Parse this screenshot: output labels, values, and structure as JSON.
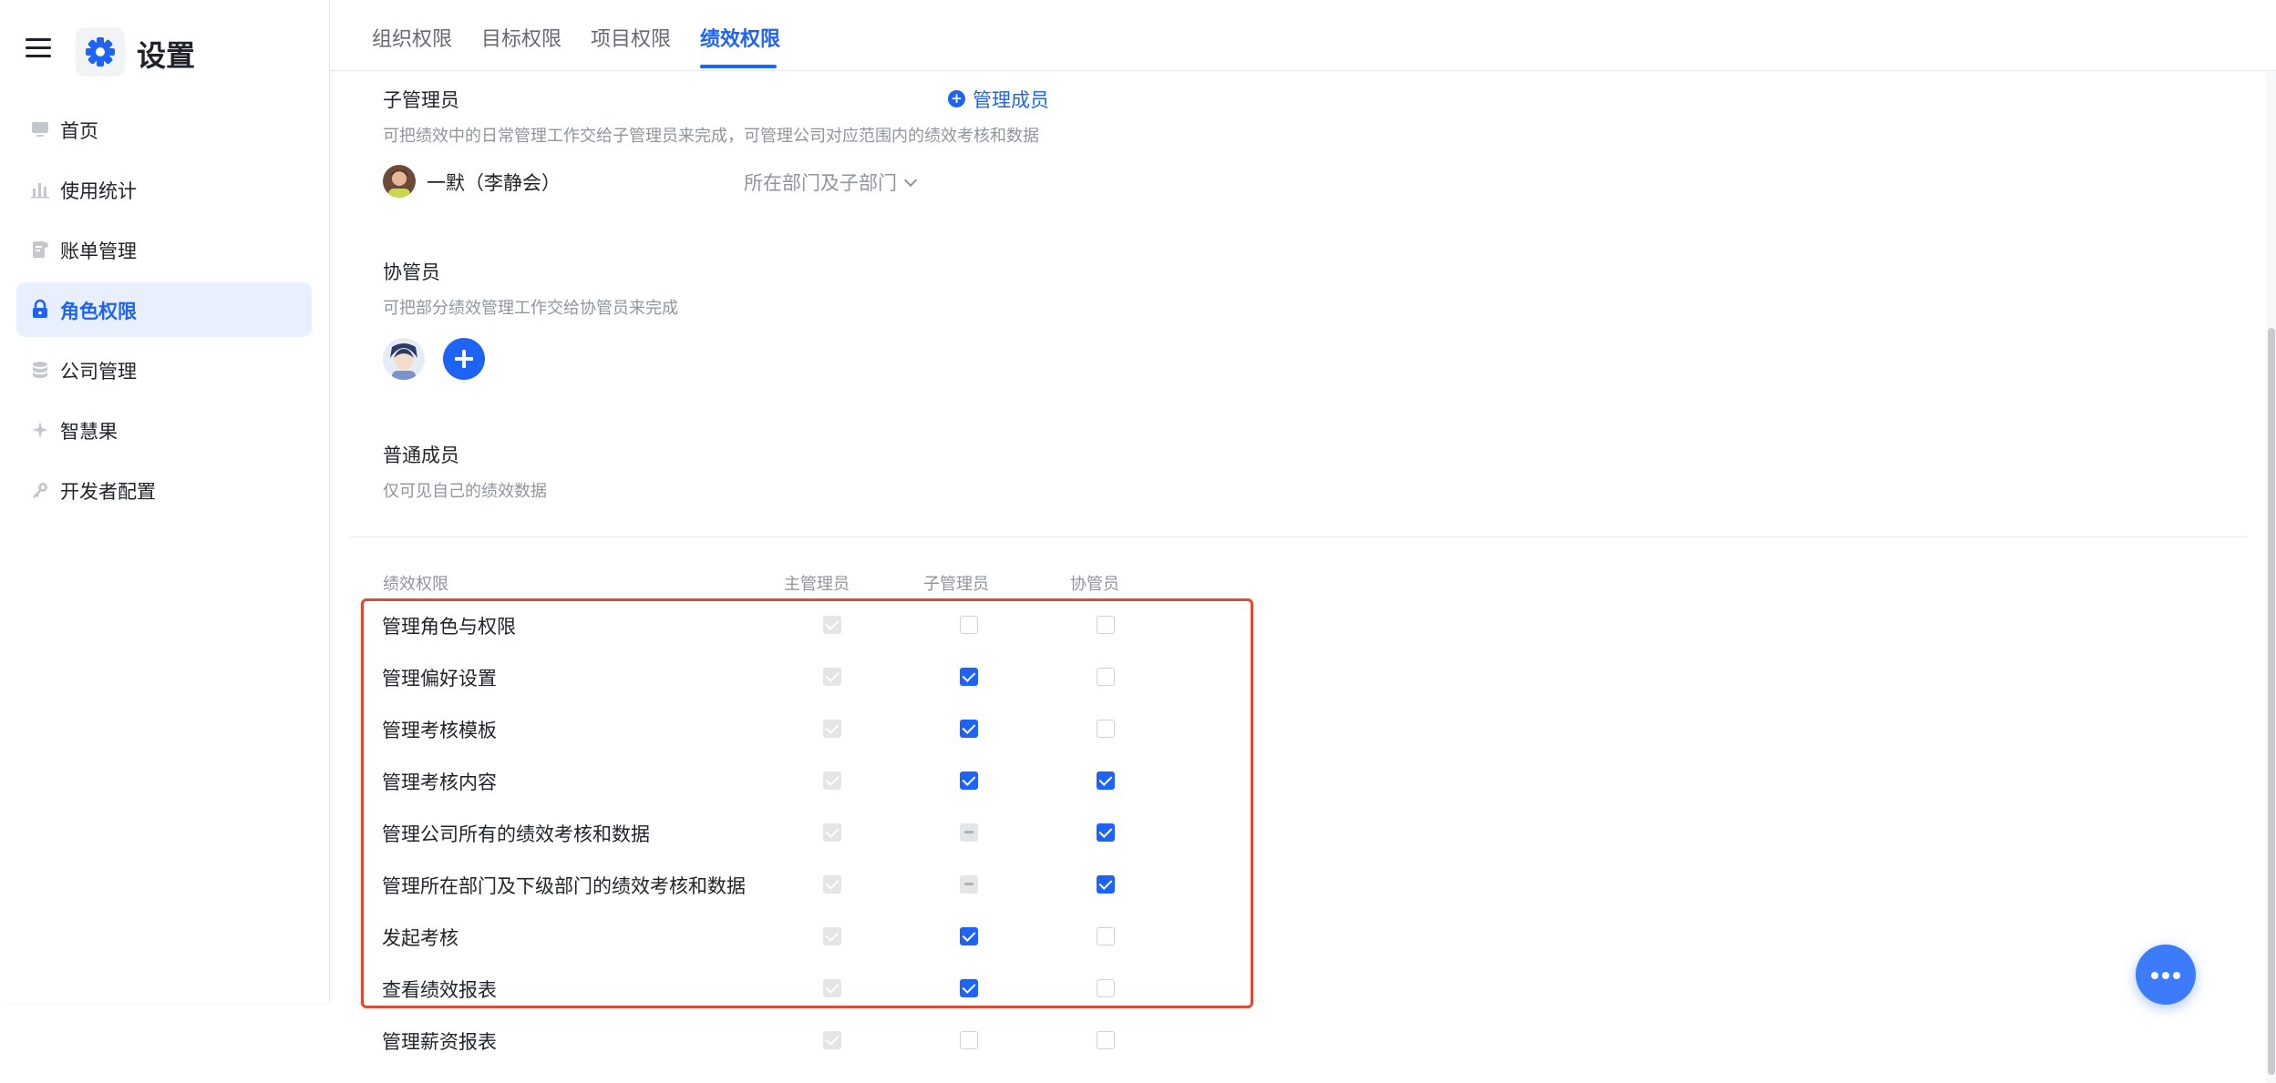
{
  "app": {
    "title": "设置"
  },
  "sidebar": {
    "items": [
      {
        "label": "首页",
        "icon": "monitor-icon"
      },
      {
        "label": "使用统计",
        "icon": "bar-chart-icon"
      },
      {
        "label": "账单管理",
        "icon": "bill-icon"
      },
      {
        "label": "角色权限",
        "icon": "lock-icon",
        "active": true
      },
      {
        "label": "公司管理",
        "icon": "database-icon"
      },
      {
        "label": "智慧果",
        "icon": "sparkle-icon"
      },
      {
        "label": "开发者配置",
        "icon": "key-icon"
      }
    ]
  },
  "tabs": [
    {
      "label": "组织权限"
    },
    {
      "label": "目标权限"
    },
    {
      "label": "项目权限"
    },
    {
      "label": "绩效权限",
      "active": true
    }
  ],
  "sub_admin": {
    "title": "子管理员",
    "desc": "可把绩效中的日常管理工作交给子管理员来完成，可管理公司对应范围内的绩效考核和数据",
    "manage_link": "管理成员",
    "member_name": "一默（李静会）",
    "scope": "所在部门及子部门"
  },
  "co_admin": {
    "title": "协管员",
    "desc": "可把部分绩效管理工作交给协管员来完成"
  },
  "member": {
    "title": "普通成员",
    "desc": "仅可见自己的绩效数据"
  },
  "permissions": {
    "headers": [
      "绩效权限",
      "主管理员",
      "子管理员",
      "协管员"
    ],
    "rows": [
      {
        "label": "管理角色与权限",
        "states": [
          "disabled-checked",
          "unchecked",
          "unchecked"
        ]
      },
      {
        "label": "管理偏好设置",
        "states": [
          "disabled-checked",
          "checked",
          "unchecked"
        ]
      },
      {
        "label": "管理考核模板",
        "states": [
          "disabled-checked",
          "checked",
          "unchecked"
        ]
      },
      {
        "label": "管理考核内容",
        "states": [
          "disabled-checked",
          "checked",
          "checked"
        ]
      },
      {
        "label": "管理公司所有的绩效考核和数据",
        "states": [
          "disabled-checked",
          "indeterminate",
          "checked"
        ]
      },
      {
        "label": "管理所在部门及下级部门的绩效考核和数据",
        "states": [
          "disabled-checked",
          "indeterminate",
          "checked"
        ]
      },
      {
        "label": "发起考核",
        "states": [
          "disabled-checked",
          "checked",
          "unchecked"
        ]
      },
      {
        "label": "查看绩效报表",
        "states": [
          "disabled-checked",
          "checked",
          "unchecked"
        ]
      },
      {
        "label": "管理薪资报表",
        "states": [
          "disabled-checked",
          "unchecked",
          "unchecked"
        ]
      }
    ]
  },
  "colors": {
    "accent": "#1f63f5",
    "highlight": "#e5482f",
    "muted_text": "#8f959e"
  }
}
